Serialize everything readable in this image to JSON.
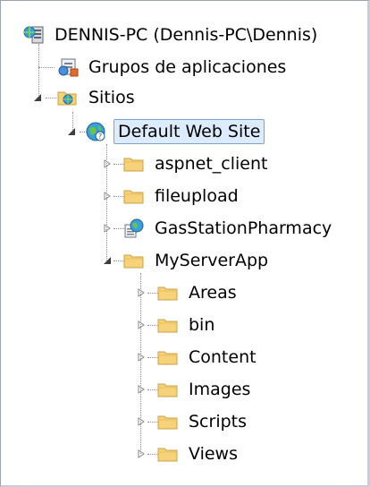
{
  "tree": {
    "root": {
      "label": "DENNIS-PC (Dennis-PC\\Dennis)",
      "icon": "server-icon"
    },
    "app_pools": {
      "label": "Grupos de aplicaciones",
      "icon": "app-pool-icon"
    },
    "sites": {
      "label": "Sitios",
      "icon": "sites-folder-icon",
      "expanded": true
    },
    "default_site": {
      "label": "Default Web Site",
      "icon": "globe-icon",
      "expanded": true,
      "selected": true
    },
    "children": [
      {
        "label": "aspnet_client",
        "icon": "folder-icon",
        "expanded": false
      },
      {
        "label": "fileupload",
        "icon": "folder-icon",
        "expanded": false
      },
      {
        "label": "GasStationPharmacy",
        "icon": "web-app-icon",
        "expanded": false
      },
      {
        "label": "MyServerApp",
        "icon": "folder-icon",
        "expanded": true
      }
    ],
    "myserverapp_children": [
      {
        "label": "Areas",
        "icon": "folder-icon"
      },
      {
        "label": "bin",
        "icon": "folder-icon"
      },
      {
        "label": "Content",
        "icon": "folder-icon"
      },
      {
        "label": "Images",
        "icon": "folder-icon"
      },
      {
        "label": "Scripts",
        "icon": "folder-icon"
      },
      {
        "label": "Views",
        "icon": "folder-icon"
      }
    ]
  },
  "colors": {
    "selection_bg": "#dcecfc",
    "selection_border": "#7da2ce",
    "folder_fill": "#f6d27a",
    "folder_edge": "#c9a043"
  }
}
